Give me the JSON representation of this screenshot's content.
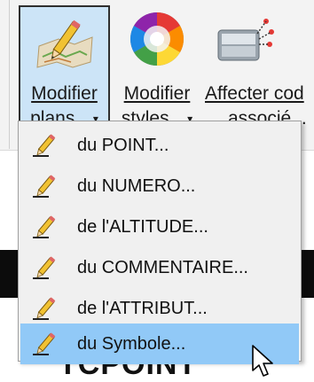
{
  "ribbon": {
    "buttons": [
      {
        "line1": "Modifier",
        "line2": "plans...",
        "icon": "map-pencil-icon",
        "selected": true
      },
      {
        "line1": "Modifier",
        "line2": "styles...",
        "icon": "color-wheel-icon",
        "selected": false
      },
      {
        "line1": "Affecter cod",
        "line2": "associé...",
        "icon": "code-assign-icon",
        "selected": false
      }
    ],
    "caret": "▾"
  },
  "menu": {
    "items": [
      {
        "label": "du POINT...",
        "icon": "pencil-icon",
        "highlighted": false
      },
      {
        "label": "du NUMERO...",
        "icon": "pencil-icon",
        "highlighted": false
      },
      {
        "label": "de l'ALTITUDE...",
        "icon": "pencil-icon",
        "highlighted": false
      },
      {
        "label": "du COMMENTAIRE...",
        "icon": "pencil-icon",
        "highlighted": false
      },
      {
        "label": "de l'ATTRIBUT...",
        "icon": "pencil-icon",
        "highlighted": false
      },
      {
        "label": "du Symbole...",
        "icon": "pencil-icon",
        "highlighted": true
      }
    ]
  },
  "background": {
    "partial_text": "TCPOINT"
  },
  "colors": {
    "ribbon_bg": "#f3f3f3",
    "selected_bg": "#cce4f7",
    "menu_bg": "#f0f0f0",
    "highlight_bg": "#91c9f7"
  }
}
